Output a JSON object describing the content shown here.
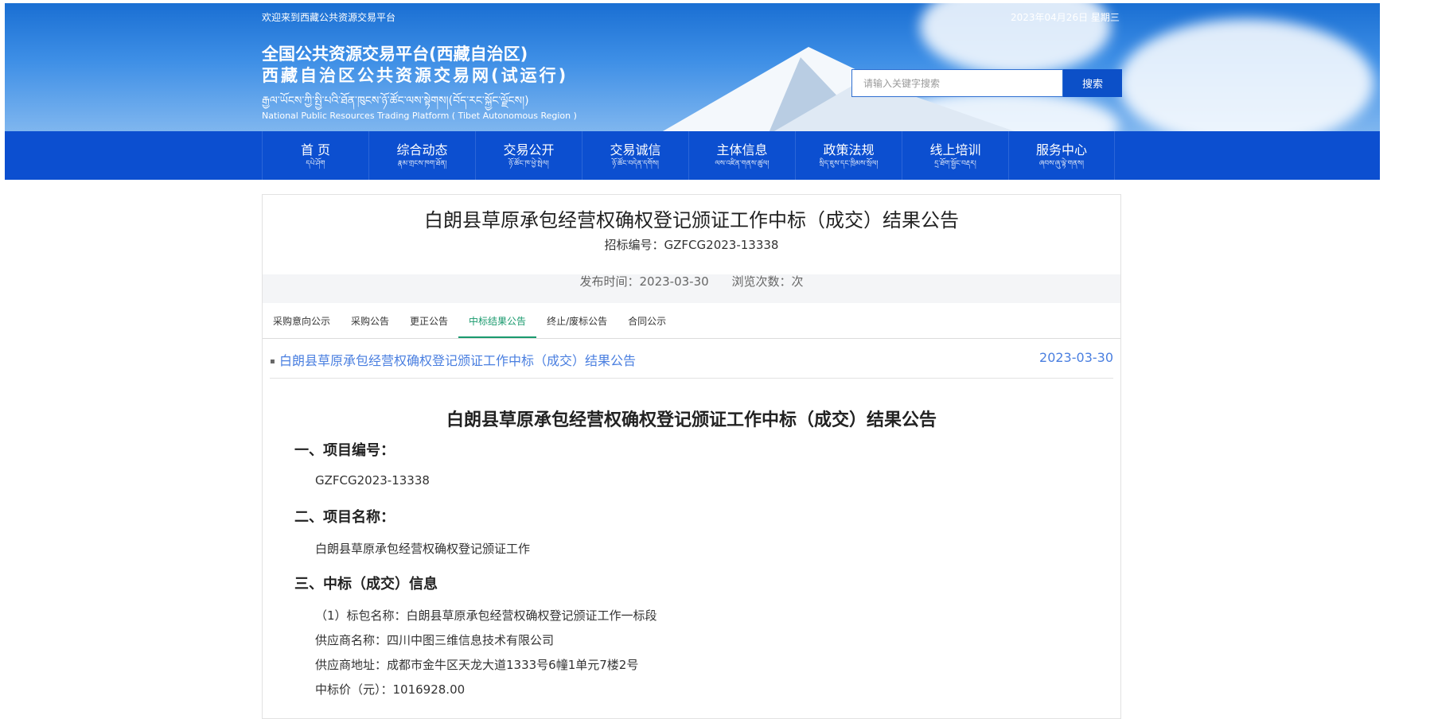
{
  "header": {
    "welcome": "欢迎来到西藏公共资源交易平台",
    "date": "2023年04月26日  星期三",
    "title_line1": "全国公共资源交易平台(西藏自治区)",
    "title_line2": "西藏自治区公共资源交易网(试运行)",
    "title_tibetan": "རྒྱལ་ཡོངས་ཀྱི་སྤྱི་པའི་ཐོན་ཁུངས་ཉོ་ཚོང་ལས་སྟེགས།(བོད་རང་སྐྱོང་ལྗོངས།)",
    "title_english": "National Public Resources Trading Platform ( Tibet Autonomous Region )",
    "search_placeholder": "请输入关键字搜索",
    "search_button": "搜索"
  },
  "nav": [
    {
      "label": "首 页",
      "sub": "དཔེ་ཤོག"
    },
    {
      "label": "综合动态",
      "sub": "རྣམ་གྲངས་ཁག་ཐོན།"
    },
    {
      "label": "交易公开",
      "sub": "ཉོ་ཚོང་ཁ་ཕྱེ་སྤེལ།"
    },
    {
      "label": "交易诚信",
      "sub": "ཉོ་ཚོང་བདེན་དགོས།"
    },
    {
      "label": "主体信息",
      "sub": "ལས་འཛིན་གནས་ཚུལ།"
    },
    {
      "label": "政策法规",
      "sub": "སྲིད་ཇུས་དང་ཁྲིམས་སྲོལ།"
    },
    {
      "label": "线上培训",
      "sub": "དྲ་ཐོག་སྦྱོང་བརྡར།"
    },
    {
      "label": "服务中心",
      "sub": "ཞབས་ཞུ་ལྟེ་གནས།"
    }
  ],
  "article": {
    "title": "白朗县草原承包经营权确权登记颁证工作中标（成交）结果公告",
    "code_line": "招标编号：GZFCG2023-13338",
    "publish_time": "发布时间：2023-03-30",
    "views": "浏览次数：次"
  },
  "tabs": [
    {
      "label": "采购意向公示",
      "active": false
    },
    {
      "label": "采购公告",
      "active": false
    },
    {
      "label": "更正公告",
      "active": false
    },
    {
      "label": "中标结果公告",
      "active": true
    },
    {
      "label": "终止/废标公告",
      "active": false
    },
    {
      "label": "合同公示",
      "active": false
    }
  ],
  "list": [
    {
      "title": "白朗县草原承包经营权确权登记颁证工作中标（成交）结果公告",
      "date": "2023-03-30"
    }
  ],
  "body": {
    "title": "白朗县草原承包经营权确权登记颁证工作中标（成交）结果公告",
    "sec1": "一、项目编号：",
    "sec1_value": "GZFCG2023-13338",
    "sec2": "二、项目名称：",
    "sec2_value": "白朗县草原承包经营权确权登记颁证工作",
    "sec3": "三、中标（成交）信息",
    "lot_name": "（1）标包名称：白朗县草原承包经营权确权登记颁证工作一标段",
    "supplier_name": "供应商名称：四川中图三维信息技术有限公司",
    "supplier_address": "供应商地址：成都市金牛区天龙大道1333号6幢1单元7楼2号",
    "bid_price": "中标价（元）：1016928.00"
  }
}
